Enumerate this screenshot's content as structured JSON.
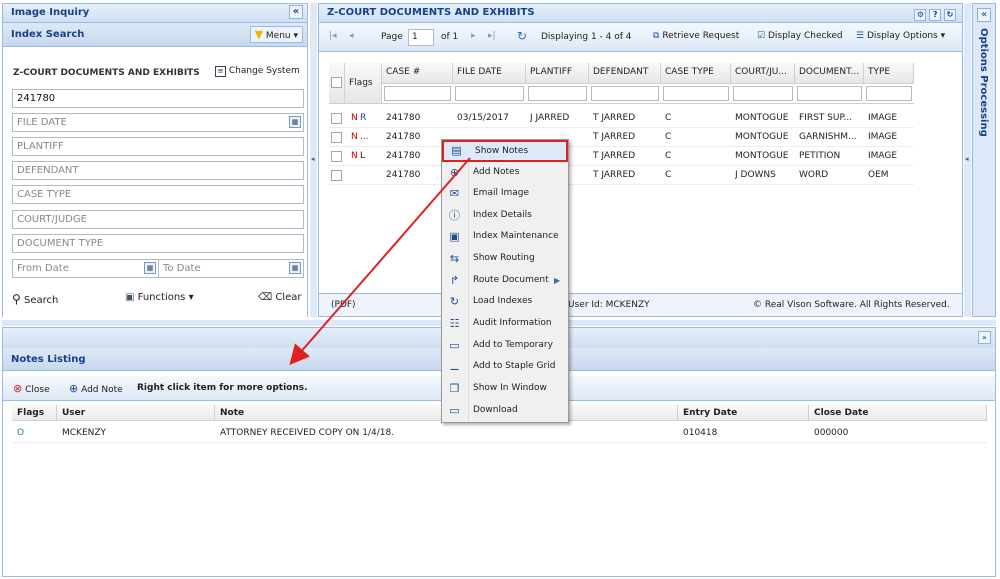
{
  "left_panel": {
    "title": "Image Inquiry",
    "collapse": "«",
    "subtitle": "Index Search",
    "menu_label": "Menu ▾",
    "system_name": "Z-COURT DOCUMENTS AND EXHIBITS",
    "change_system": "Change System",
    "fields": {
      "case_value": "241780",
      "file_date": "FILE DATE",
      "plantiff": "PLANTIFF",
      "defendant": "DEFENDANT",
      "case_type": "CASE TYPE",
      "court_judge": "COURT/JUDGE",
      "document_type": "DOCUMENT TYPE",
      "from_date": "From Date",
      "to_date": "To Date"
    },
    "search": "Search",
    "functions": "Functions ▾",
    "clear": "Clear"
  },
  "main_panel": {
    "title": "Z-COURT DOCUMENTS AND EXHIBITS",
    "toolbar": {
      "page_label": "Page",
      "page_value": "1",
      "of_label": "of 1",
      "displaying": "Displaying 1 - 4 of 4",
      "retrieve": "Retrieve Request",
      "display_checked": "Display Checked",
      "display_options": "Display Options ▾"
    },
    "columns": [
      "Flags",
      "CASE #",
      "FILE DATE",
      "PLANTIFF",
      "DEFENDANT",
      "CASE TYPE",
      "COURT/JU...",
      "DOCUMENT...",
      "TYPE"
    ],
    "rows": [
      {
        "flag1": "N",
        "flag2": "R",
        "case": "241780",
        "date": "03/15/2017",
        "plantiff": "J JARRED",
        "defendant": "T JARRED",
        "ctype": "C",
        "court": "MONTOGUE",
        "doc": "FIRST SUP...",
        "type": "IMAGE"
      },
      {
        "flag1": "N",
        "flag2": "...",
        "case": "241780",
        "date": "",
        "plantiff": "",
        "defendant": "T JARRED",
        "ctype": "C",
        "court": "MONTOGUE",
        "doc": "GARNISHM...",
        "type": "IMAGE"
      },
      {
        "flag1": "N",
        "flag2": "L",
        "case": "241780",
        "date": "",
        "plantiff": "",
        "defendant": "T JARRED",
        "ctype": "C",
        "court": "MONTOGUE",
        "doc": "PETITION",
        "type": "IMAGE"
      },
      {
        "flag1": "",
        "flag2": "",
        "case": "241780",
        "date": "",
        "plantiff": "",
        "defendant": "T JARRED",
        "ctype": "C",
        "court": "J DOWNS",
        "doc": "WORD",
        "type": "OEM"
      }
    ],
    "status_pdf": "(PDF)",
    "status_user": "User Id: MCKENZY",
    "status_copyright": "© Real Vison Software. All Rights Reserved."
  },
  "right_panel": {
    "title": "Options Processing",
    "collapse": "«"
  },
  "context_menu": [
    {
      "label": "Show Notes",
      "icon": "notes-icon"
    },
    {
      "label": "Add Notes",
      "icon": "add-icon"
    },
    {
      "label": "Email Image",
      "icon": "email-icon"
    },
    {
      "label": "Index Details",
      "icon": "info-icon"
    },
    {
      "label": "Index Maintenance",
      "icon": "maintenance-icon"
    },
    {
      "label": "Show Routing",
      "icon": "routing-icon"
    },
    {
      "label": "Route Document",
      "icon": "route-icon"
    },
    {
      "label": "Load Indexes",
      "icon": "refresh-icon"
    },
    {
      "label": "Audit Information",
      "icon": "audit-icon"
    },
    {
      "label": "Add to Temporary",
      "icon": "save-icon"
    },
    {
      "label": "Add to Staple Grid",
      "icon": "staple-icon"
    },
    {
      "label": "Show In Window",
      "icon": "window-icon"
    },
    {
      "label": "Download",
      "icon": "download-icon"
    }
  ],
  "notes": {
    "title": "Notes Listing",
    "close": "Close",
    "add_note": "Add Note",
    "hint": "Right click item for more options.",
    "columns": [
      "Flags",
      "User",
      "Note",
      "Entry Date",
      "Close Date"
    ],
    "rows": [
      {
        "flag": "O",
        "user": "MCKENZY",
        "note": "ATTORNEY RECEIVED COPY ON 1/4/18.",
        "entry": "010418",
        "close": "000000"
      }
    ]
  },
  "colors": {
    "accent": "#15428b",
    "highlight_border": "#e02020",
    "arrow": "#e02020",
    "flag_red": "#cc0000",
    "flag_blue": "#1a3fb8",
    "flag_green": "#2a8a2a"
  }
}
